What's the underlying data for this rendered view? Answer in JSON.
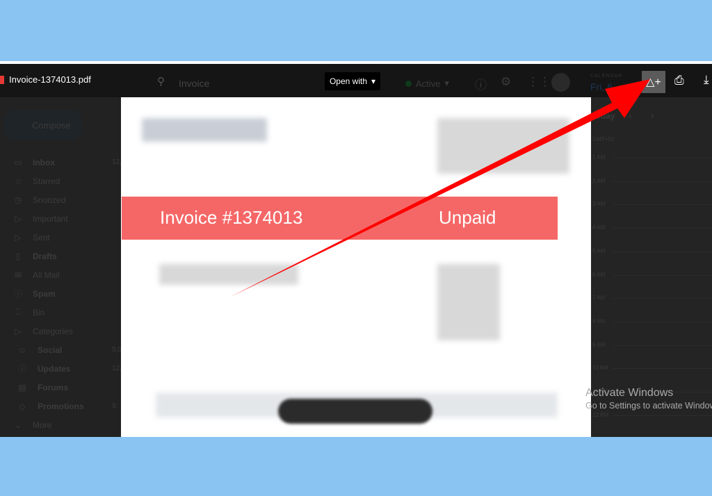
{
  "viewer": {
    "file_name": "Invoice-1374013.pdf",
    "open_with_label": "Open with",
    "drive_icon": "add-to-drive-icon",
    "print_icon": "print-icon",
    "download_icon": "download-icon"
  },
  "gmail": {
    "search_value": "Invoice",
    "status_label": "Active",
    "compose_label": "Compose",
    "nav": [
      {
        "label": "Inbox",
        "count": "12,",
        "icon": "inbox-icon"
      },
      {
        "label": "Starred",
        "icon": "star-icon"
      },
      {
        "label": "Snoozed",
        "icon": "clock-icon"
      },
      {
        "label": "Important",
        "icon": "important-icon"
      },
      {
        "label": "Sent",
        "icon": "send-icon"
      },
      {
        "label": "Drafts",
        "icon": "draft-icon"
      },
      {
        "label": "All Mail",
        "icon": "all-mail-icon"
      },
      {
        "label": "Spam",
        "icon": "spam-icon"
      },
      {
        "label": "Bin",
        "icon": "trash-icon"
      },
      {
        "label": "Categories",
        "icon": "label-icon"
      },
      {
        "label": "Social",
        "count": "5,0",
        "icon": "people-icon"
      },
      {
        "label": "Updates",
        "count": "12,",
        "icon": "info-icon"
      },
      {
        "label": "Forums",
        "icon": "forum-icon"
      },
      {
        "label": "Promotions",
        "count": "9,",
        "icon": "tag-icon"
      },
      {
        "label": "More",
        "icon": "chevron-down-icon"
      }
    ]
  },
  "calendar": {
    "label": "CALENDAR",
    "date": "Fri, 6",
    "today": "Today",
    "timezone": "GMT+01",
    "hours": [
      "1 AM",
      "2 AM",
      "3 AM",
      "4 AM",
      "5 AM",
      "6 AM",
      "7 AM",
      "8 AM",
      "9 AM",
      "10 AM",
      "11 AM",
      "12 PM"
    ]
  },
  "invoice": {
    "title": "Invoice #1374013",
    "status": "Unpaid",
    "band_color": "#f56767"
  },
  "watermark": {
    "line1": "Activate Windows",
    "line2": "Go to Settings to activate Windows."
  },
  "annotation": {
    "arrow_color": "#ff0000"
  }
}
